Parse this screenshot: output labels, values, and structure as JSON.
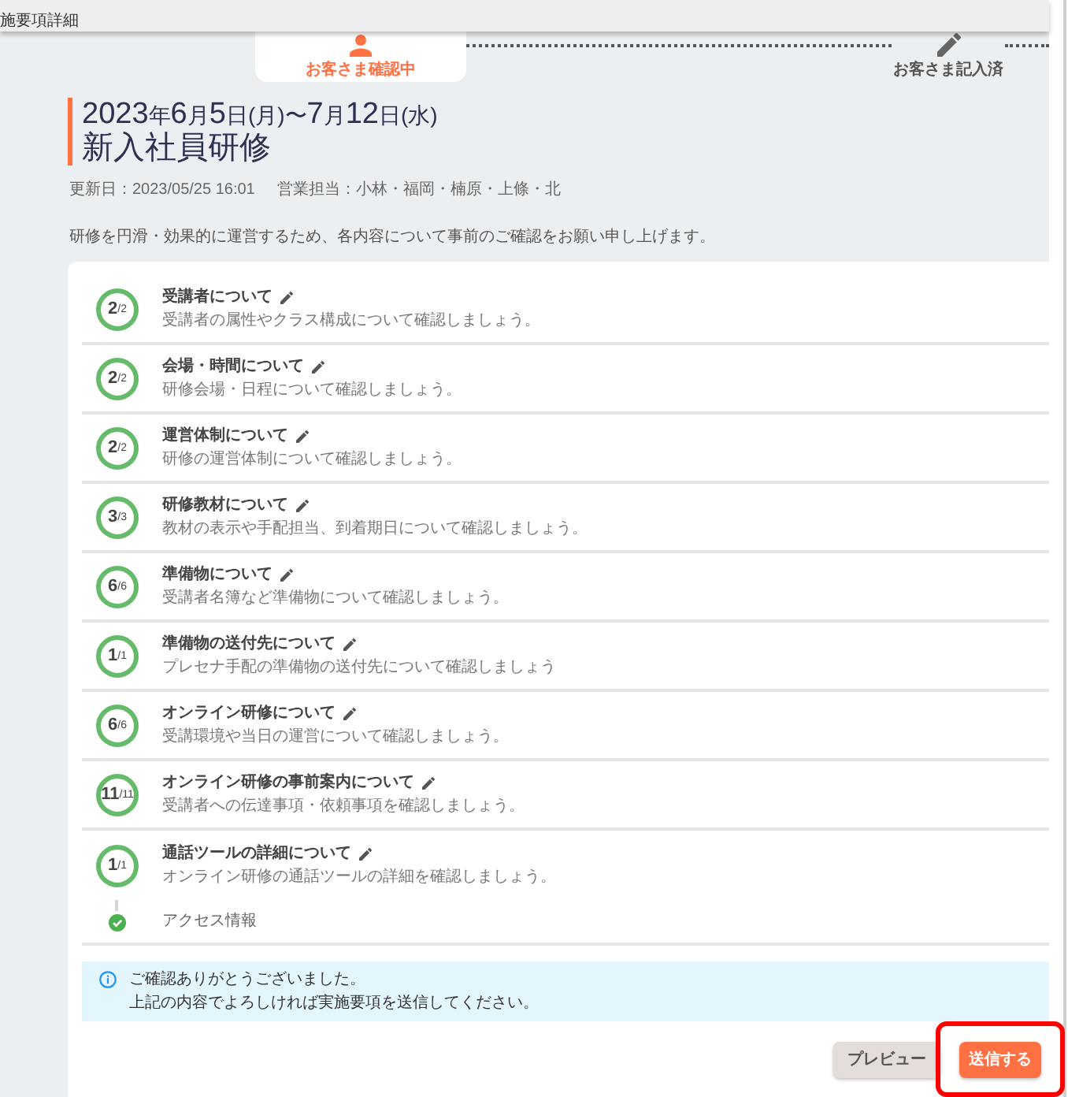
{
  "header": {
    "title": "施要項詳細"
  },
  "steps": [
    {
      "kind": "review",
      "label": "お客さま確認中",
      "selected": true
    },
    {
      "kind": "entry",
      "label": "お客さま記入済",
      "selected": false
    }
  ],
  "training": {
    "period": "2023年6月5日(月)〜7月12日(水)",
    "name": "新入社員研修",
    "updated": "更新日：2023/05/25 16:01",
    "sales": "営業担当：小林・福岡・楠原・上條・北",
    "intro": "研修を円滑・効果的に運営するため、各内容について事前のご確認をお願い申し上げます。"
  },
  "sections": [
    {
      "title": "受講者について",
      "description": "受講者の属性やクラス構成について確認しましょう。",
      "done": "2",
      "total": "/2",
      "complete": true
    },
    {
      "title": "会場・時間について",
      "description": "研修会場・日程について確認しましょう。",
      "done": "2",
      "total": "/2",
      "complete": true
    },
    {
      "title": "運営体制について",
      "description": "研修の運営体制について確認しましょう。",
      "done": "2",
      "total": "/2",
      "complete": true
    },
    {
      "title": "研修教材について",
      "description": "教材の表示や手配担当、到着期日について確認しましょう。",
      "done": "3",
      "total": "/3",
      "complete": true
    },
    {
      "title": "準備物について",
      "description": "受講者名簿など準備物について確認しましょう。",
      "done": "6",
      "total": "/6",
      "complete": true
    },
    {
      "title": "準備物の送付先について",
      "description": "プレセナ手配の準備物の送付先について確認しましょう",
      "done": "1",
      "total": "/1",
      "complete": true
    },
    {
      "title": "オンライン研修について",
      "description": "受講環境や当日の運営について確認しましょう。",
      "done": "6",
      "total": "/6",
      "complete": true
    },
    {
      "title": "オンライン研修の事前案内について",
      "description": "受講者への伝達事項・依頼事項を確認しましょう。",
      "done": "11",
      "total": "/11",
      "complete": true
    },
    {
      "title": "通話ツールの詳細について",
      "description": "オンライン研修の通話ツールの詳細を確認しましょう。",
      "done": "1",
      "total": "/1",
      "complete": true
    }
  ],
  "access": {
    "label": "アクセス情報",
    "checked": true
  },
  "notice": {
    "lines": [
      "ご確認ありがとうございました。",
      "上記の内容でよろしければ実施要項を送信してください。"
    ]
  },
  "buttons": [
    {
      "kind": "secondary",
      "label": "プレビュー",
      "highlighted": false
    },
    {
      "kind": "primary",
      "label": "送信する",
      "highlighted": true
    }
  ]
}
